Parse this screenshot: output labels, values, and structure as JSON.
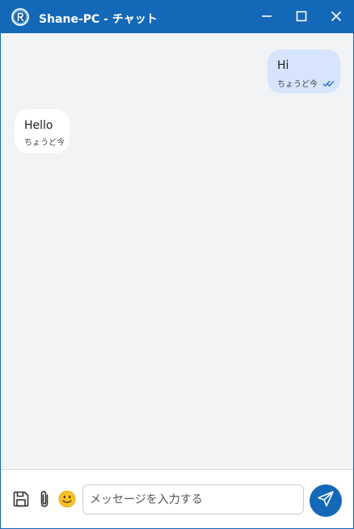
{
  "window": {
    "title": "Shane-PC - チャット",
    "logo_icon": "app-logo-icon",
    "controls": [
      "minimize-icon",
      "maximize-icon",
      "close-icon"
    ],
    "accent_color": "#1468b8"
  },
  "messages": [
    {
      "direction": "outgoing",
      "text": "Hi",
      "time": "ちょうど今",
      "status_icon": "double-check-icon"
    },
    {
      "direction": "incoming",
      "text": "Hello",
      "time": "ちょうど今"
    }
  ],
  "composer": {
    "placeholder": "メッセージを入力する",
    "value": "",
    "icons": [
      "save-icon",
      "paperclip-icon",
      "emoji-icon",
      "send-icon"
    ]
  }
}
